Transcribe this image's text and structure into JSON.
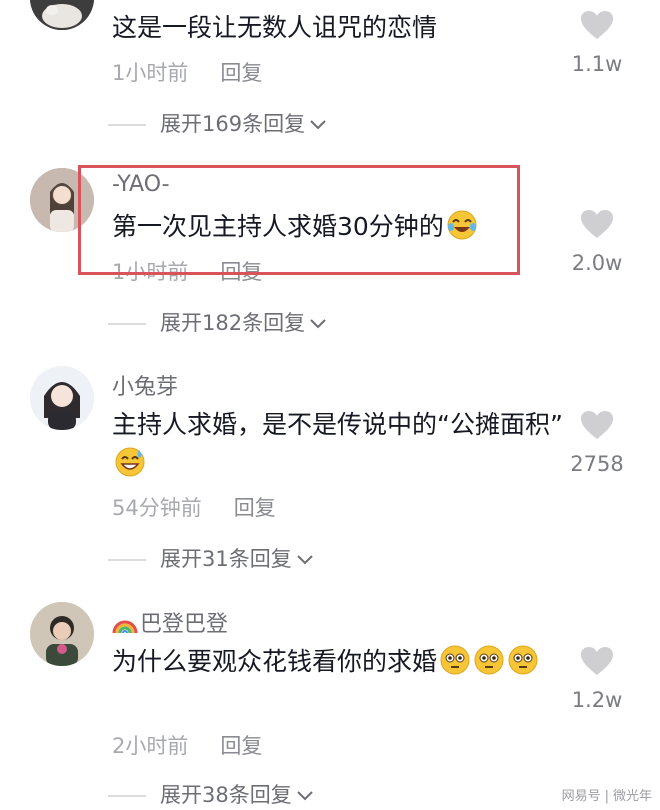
{
  "comments": [
    {
      "text": "这是一段让无数人诅咒的恋情",
      "time": "1小时前",
      "reply": "回复",
      "likes": "1.1w",
      "expand": "展开169条回复"
    },
    {
      "username": "-YAO-",
      "text": "第一次见主持人求婚30分钟的",
      "emoji": "rofl-emoji",
      "time": "1小时前",
      "reply": "回复",
      "likes": "2.0w",
      "expand": "展开182条回复"
    },
    {
      "username": "小兔芽",
      "text": "主持人求婚，是不是传说中的“公摊面积”",
      "emoji": "sweat-smile-emoji",
      "time": "54分钟前",
      "reply": "回复",
      "likes": "2758",
      "expand": "展开31条回复"
    },
    {
      "username": "巴登巴登",
      "username_icon": "rainbow-icon",
      "text": "为什么要观众花钱看你的求婚",
      "emoji": "flushed-emoji",
      "time": "2小时前",
      "reply": "回复",
      "likes": "1.2w",
      "expand": "展开38条回复"
    }
  ],
  "watermark": {
    "left": "网易号",
    "sep": "|",
    "right": "微光年"
  },
  "colors": {
    "highlight_border": "#d9535a",
    "heart": "#cfcfd2",
    "meta_text": "#a8a9ae",
    "body_text": "#161823"
  }
}
